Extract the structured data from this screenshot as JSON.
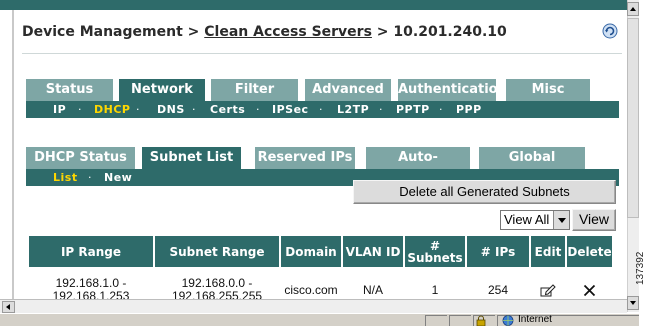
{
  "breadcrumb": {
    "root": "Device Management",
    "sep1": ">",
    "link": "Clean Access Servers",
    "sep2": ">",
    "current": "10.201.240.10"
  },
  "main_tabs": [
    {
      "label": "Status"
    },
    {
      "label": "Network",
      "active": true
    },
    {
      "label": "Filter"
    },
    {
      "label": "Advanced"
    },
    {
      "label": "Authentication"
    },
    {
      "label": "Misc"
    }
  ],
  "network_subtabs": [
    {
      "label": "IP"
    },
    {
      "label": "DHCP",
      "selected": true
    },
    {
      "label": "DNS"
    },
    {
      "label": "Certs"
    },
    {
      "label": "IPSec"
    },
    {
      "label": "L2TP"
    },
    {
      "label": "PPTP"
    },
    {
      "label": "PPP"
    }
  ],
  "dhcp_tabs": [
    {
      "label": "DHCP Status"
    },
    {
      "label": "Subnet List",
      "active": true
    },
    {
      "label": "Reserved IPs"
    },
    {
      "label": "Auto-Generate"
    },
    {
      "label": "Global Options"
    }
  ],
  "subnet_subtabs": [
    {
      "label": "List",
      "selected": true
    },
    {
      "label": "New"
    }
  ],
  "separator": "·",
  "actions": {
    "delete_all_label": "Delete all Generated Subnets",
    "filter_value": "View All",
    "view_label": "View"
  },
  "table": {
    "headers": [
      "IP Range",
      "Subnet Range",
      "Domain",
      "VLAN ID",
      "# Subnets",
      "# IPs",
      "Edit",
      "Delete"
    ],
    "rows": [
      {
        "ip_range": "192.168.1.0 - 192.168.1.253",
        "subnet_range": "192.168.0.0 - 192.168.255.255",
        "domain": "cisco.com",
        "vlan_id": "N/A",
        "subnets": "1",
        "ips": "254",
        "edit_icon": "edit-icon",
        "delete_icon": "delete-x-icon"
      }
    ]
  },
  "status_bar": {
    "zone": "Internet"
  },
  "figure_number": "137392",
  "colors": {
    "tab_active": "#2e6b6a",
    "tab_inactive": "#7ea6a5",
    "selected_subtab": "#ffd700"
  }
}
